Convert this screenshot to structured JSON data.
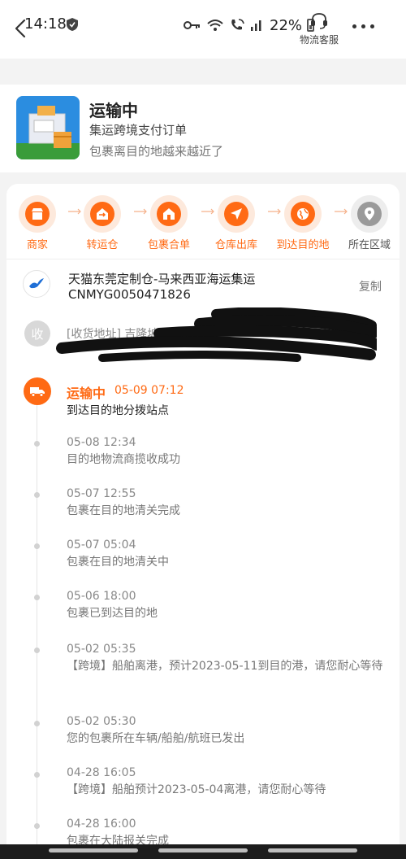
{
  "status_bar": {
    "time": "14:18",
    "battery": "22%",
    "customer_service_label": "物流客服"
  },
  "header": {
    "status": "运输中",
    "order_type": "集运跨境支付订单",
    "message": "包裹离目的地越来越近了"
  },
  "progress_steps": [
    {
      "label": "商家",
      "icon": "store-icon",
      "state": "done"
    },
    {
      "label": "转运仓",
      "icon": "transfer-icon",
      "state": "done"
    },
    {
      "label": "包裹合单",
      "icon": "warehouse-icon",
      "state": "done"
    },
    {
      "label": "仓库出库",
      "icon": "paper-plane-icon",
      "state": "done"
    },
    {
      "label": "到达目的地",
      "icon": "globe-icon",
      "state": "done"
    },
    {
      "label": "所在区域",
      "icon": "location-pin-icon",
      "state": "todo"
    }
  ],
  "carrier": {
    "name": "天猫东莞定制仓-马来西亚海运集运",
    "tracking_no": "CNMYG0050471826",
    "copy_label": "复制"
  },
  "address": {
    "badge": "收",
    "text": "[收货地址] 吉隆坡吉隆坡"
  },
  "current_event": {
    "status": "运输中",
    "time": "05-09 07:12",
    "desc": "到达目的地分拨站点"
  },
  "events": [
    {
      "time": "05-08 12:34",
      "desc": "目的地物流商揽收成功"
    },
    {
      "time": "05-07 12:55",
      "desc": "包裹在目的地清关完成"
    },
    {
      "time": "05-07 05:04",
      "desc": "包裹在目的地清关中"
    },
    {
      "time": "05-06 18:00",
      "desc": "包裹已到达目的地"
    },
    {
      "time": "05-02 05:35",
      "desc": "【跨境】船舶离港，预计2023-05-11到目的港，请您耐心等待"
    },
    {
      "time": "05-02 05:30",
      "desc": "您的包裹所在车辆/船舶/航班已发出"
    },
    {
      "time": "04-28 16:05",
      "desc": "【跨境】船舶预计2023-05-04离港，请您耐心等待"
    },
    {
      "time": "04-28 16:00",
      "desc": "包裹在大陆报关完成"
    }
  ],
  "colors": {
    "accent": "#ff6a14",
    "accent_light": "#fde9dc",
    "inactive": "#9a9a9a"
  }
}
